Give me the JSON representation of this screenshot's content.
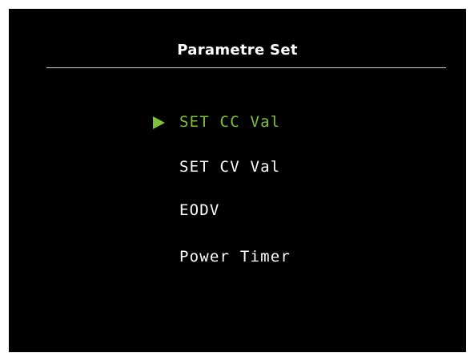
{
  "screen": {
    "title": "Parametre Set",
    "background": "#000000",
    "accent_color": "#7dc13a",
    "text_color": "#ffffff"
  },
  "menu": {
    "cursor_icon": "triangle-right-icon",
    "items": [
      {
        "label": "SET CC Val",
        "selected": true
      },
      {
        "label": "SET CV Val",
        "selected": false
      },
      {
        "label": "EODV",
        "selected": false
      },
      {
        "label": "Power Timer",
        "selected": false
      }
    ]
  }
}
